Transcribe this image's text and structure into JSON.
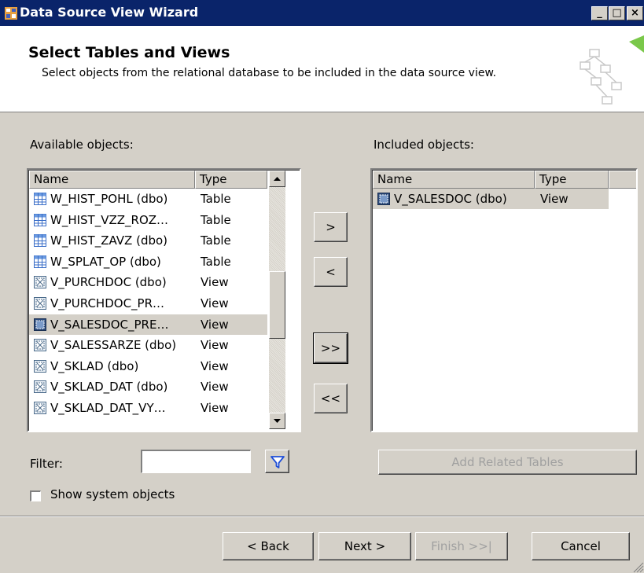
{
  "window": {
    "title": "Data Source View Wizard",
    "controls": {
      "minimize": "_",
      "maximize": "□",
      "close": "×"
    }
  },
  "header": {
    "title": "Select Tables and Views",
    "description": "Select objects from the relational database to be included in the data source view."
  },
  "available": {
    "label": "Available objects:",
    "columns": {
      "name": "Name",
      "type": "Type"
    },
    "rows": [
      {
        "name": "W_HIST_POHL (dbo)",
        "type": "Table",
        "icon": "table-icon",
        "selected": false
      },
      {
        "name": "W_HIST_VZZ_ROZ…",
        "type": "Table",
        "icon": "table-icon",
        "selected": false
      },
      {
        "name": "W_HIST_ZAVZ (dbo)",
        "type": "Table",
        "icon": "table-icon",
        "selected": false
      },
      {
        "name": "W_SPLAT_OP (dbo)",
        "type": "Table",
        "icon": "table-icon",
        "selected": false
      },
      {
        "name": "V_PURCHDOC (dbo)",
        "type": "View",
        "icon": "view-icon",
        "selected": false
      },
      {
        "name": "V_PURCHDOC_PR…",
        "type": "View",
        "icon": "view-icon",
        "selected": false
      },
      {
        "name": "V_SALESDOC_PRE…",
        "type": "View",
        "icon": "view-icon",
        "selected": true
      },
      {
        "name": "V_SALESSARZE (dbo)",
        "type": "View",
        "icon": "view-icon",
        "selected": false
      },
      {
        "name": "V_SKLAD (dbo)",
        "type": "View",
        "icon": "view-icon",
        "selected": false
      },
      {
        "name": "V_SKLAD_DAT (dbo)",
        "type": "View",
        "icon": "view-icon",
        "selected": false
      },
      {
        "name": "V_SKLAD_DAT_VY…",
        "type": "View",
        "icon": "view-icon",
        "selected": false
      }
    ]
  },
  "included": {
    "label": "Included objects:",
    "columns": {
      "name": "Name",
      "type": "Type"
    },
    "rows": [
      {
        "name": "V_SALESDOC (dbo)",
        "type": "View",
        "icon": "view-icon",
        "selected": true
      }
    ]
  },
  "transfer_buttons": {
    "add": ">",
    "remove": "<",
    "add_all": ">>",
    "remove_all": "<<"
  },
  "filter": {
    "label": "Filter:",
    "value": "",
    "icon": "filter-funnel-icon"
  },
  "show_system_objects": {
    "label": "Show system objects",
    "checked": false
  },
  "add_related_tables": "Add Related Tables",
  "footer": {
    "back": "< Back",
    "next": "Next >",
    "finish": "Finish >>|",
    "cancel": "Cancel"
  },
  "colors": {
    "title_bar": "#0a246a",
    "dialog_face": "#d4d0c8",
    "filter_icon": "#1f4fd8"
  }
}
